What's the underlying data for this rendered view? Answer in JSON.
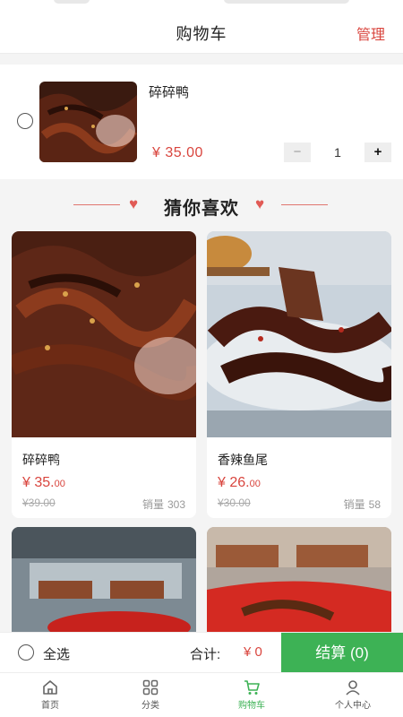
{
  "header": {
    "title": "购物车",
    "manage_label": "管理"
  },
  "cart": {
    "items": [
      {
        "name": "碎碎鸭",
        "price": "¥ 35.00",
        "quantity": "1",
        "minus": "−",
        "plus": "+"
      }
    ]
  },
  "recommend": {
    "title": "猜你喜欢",
    "heart_icon": "♥",
    "sales_label": "销量",
    "products": [
      {
        "name": "碎碎鸭",
        "price_main": "¥ 35.",
        "price_decimal": "00",
        "old_price": "¥39.00",
        "sales": "303"
      },
      {
        "name": "香辣鱼尾",
        "price_main": "¥ 26.",
        "price_decimal": "00",
        "old_price": "¥30.00",
        "sales": "58"
      }
    ]
  },
  "checkout": {
    "select_all_label": "全选",
    "total_label": "合计:",
    "total_value": "¥ 0",
    "button_label": "结算 (0)"
  },
  "tabbar": {
    "items": [
      {
        "label": "首页",
        "icon": "home-icon"
      },
      {
        "label": "分类",
        "icon": "category-grid-icon"
      },
      {
        "label": "购物车",
        "icon": "cart-icon",
        "active": true
      },
      {
        "label": "个人中心",
        "icon": "user-icon"
      }
    ]
  },
  "colors": {
    "accent_red": "#d9453e",
    "accent_green": "#3db255"
  }
}
